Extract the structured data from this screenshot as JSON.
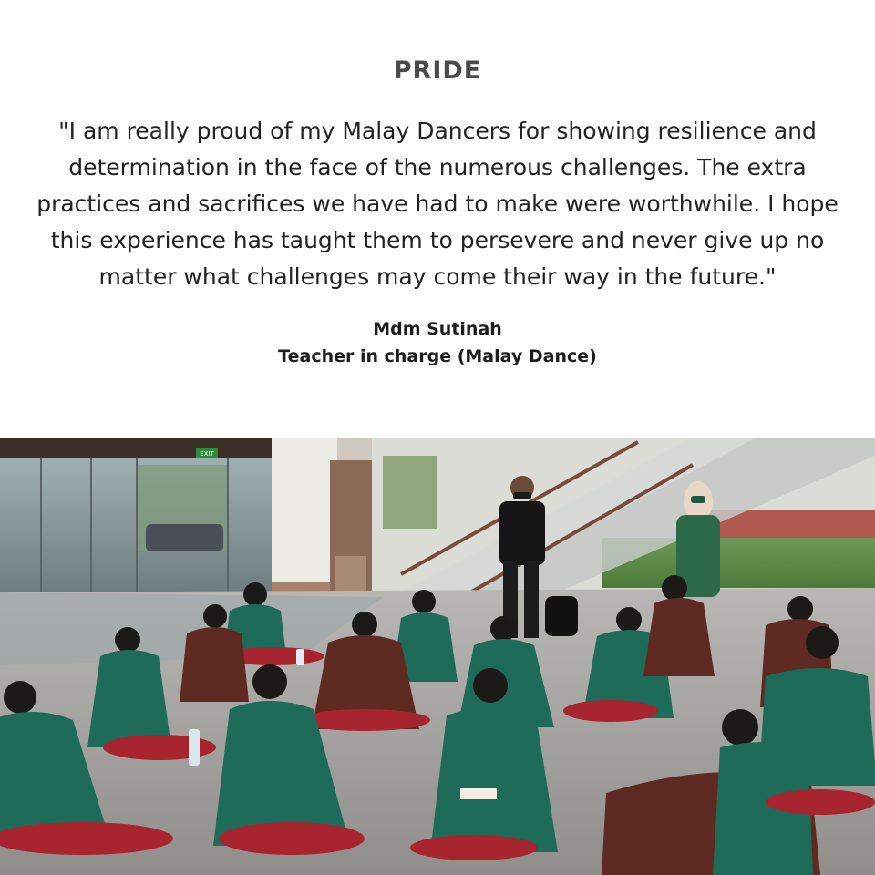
{
  "card": {
    "title": "PRIDE",
    "quote": "\"I am really proud of my Malay Dancers for showing resilience and determination in the face of the numerous challenges. The extra practices and sacrifices we have had to make were worthwhile. I hope this experience has taught them to persevere and never give up no matter what challenges may come their way in the future.\"",
    "author_name": "Mdm Sutinah",
    "author_role": "Teacher in charge (Malay Dance)"
  },
  "photo": {
    "exit_sign": "EXIT"
  },
  "colors": {
    "title": "#4a4a4a",
    "quote": "#222222",
    "costume_green": "#1f6b5a",
    "costume_maroon": "#5e2a22",
    "costume_red": "#a8242f"
  }
}
